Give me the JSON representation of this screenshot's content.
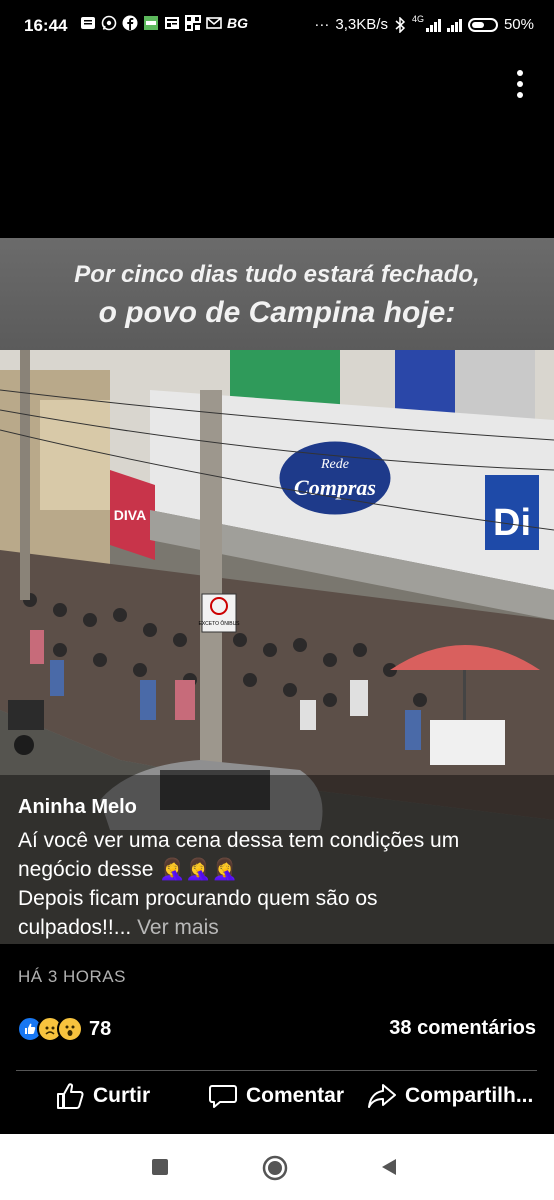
{
  "status_bar": {
    "time": "16:44",
    "bg_label": "BG",
    "overflow": "···",
    "speed": "3,3KB/s",
    "network": "4G",
    "battery": "50%"
  },
  "image": {
    "headline_line1": "Por cinco dias tudo estará fechado,",
    "headline_line2": "o povo de Campina hoje:",
    "store_sign_line1": "Rede",
    "store_sign_line2": "Compras",
    "left_sign": "DIVA",
    "right_sign": "Di",
    "street_sign": "EXCETO ÔNIBUS"
  },
  "post": {
    "author": "Aninha Melo",
    "text_lines": [
      "Aí você ver uma cena dessa tem condições um",
      "negócio desse 🤦‍♀️🤦‍♀️🤦‍♀️",
      "Depois ficam procurando quem são os",
      "culpados!!..."
    ],
    "see_more": "Ver mais",
    "timestamp": "HÁ 3 HORAS",
    "reaction_count": "78",
    "comments": "38 comentários"
  },
  "actions": {
    "like": "Curtir",
    "comment": "Comentar",
    "share": "Compartilh..."
  },
  "colors": {
    "like_blue": "#1877f2",
    "sad_yellow": "#f7c33e",
    "background": "#000000",
    "umbrella": "#d9605e",
    "store_awning": "#1e3a8a"
  },
  "icons": {
    "like": "thumbs-up-icon",
    "comment": "speech-bubble-icon",
    "share": "share-arrow-icon",
    "nav_recent": "square-icon",
    "nav_home": "circle-icon",
    "nav_back": "triangle-back-icon"
  }
}
